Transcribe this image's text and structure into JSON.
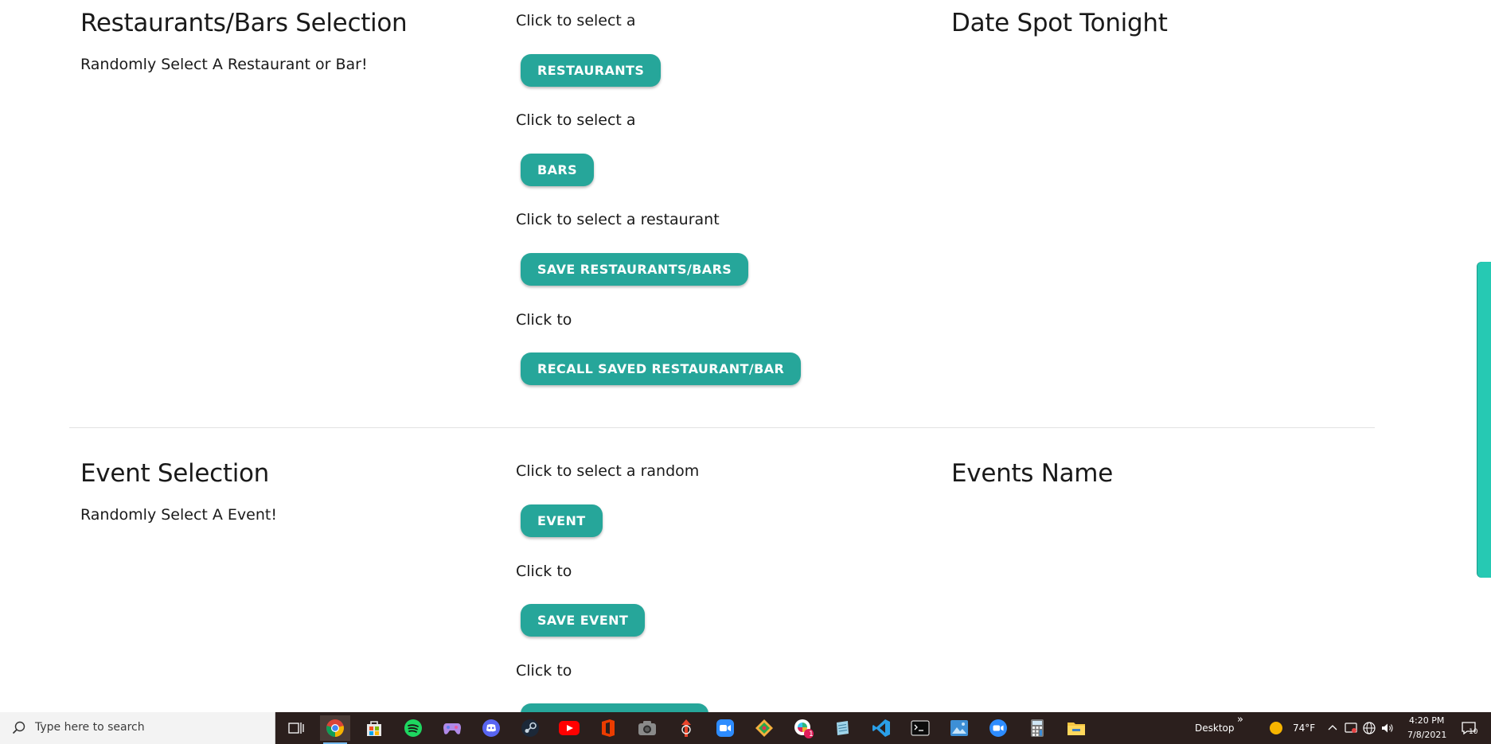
{
  "restaurants_section": {
    "title": "Restaurants/Bars Selection",
    "subtitle": "Randomly Select A Restaurant or Bar!",
    "result_title": "Date Spot Tonight",
    "actions": [
      {
        "hint": "Click to select a",
        "label": "RESTAURANTS"
      },
      {
        "hint": "Click to select a",
        "label": "BARS"
      },
      {
        "hint": "Click to select a restaurant",
        "label": "SAVE RESTAURANTS/BARS"
      },
      {
        "hint": "Click to",
        "label": "RECALL SAVED RESTAURANT/BAR"
      }
    ]
  },
  "event_section": {
    "title": "Event Selection",
    "subtitle": "Randomly Select A Event!",
    "result_title": "Events Name",
    "actions": [
      {
        "hint": "Click to select a random",
        "label": "EVENT"
      },
      {
        "hint": "Click to",
        "label": "SAVE EVENT"
      },
      {
        "hint": "Click to",
        "label": ""
      }
    ]
  },
  "colors": {
    "accent": "#26a69a",
    "scroll_tab": "#26c9b3",
    "taskbar": "#2b1f1d"
  },
  "taskbar": {
    "search_placeholder": "Type here to search",
    "apps": [
      "task-view-icon",
      "chrome-icon",
      "store-icon",
      "spotify-icon",
      "game-icon",
      "discord-icon",
      "steam-icon",
      "youtube-icon",
      "office-icon",
      "camera-icon",
      "app-icon",
      "zoom-icon",
      "gitkraken-icon",
      "slack-icon",
      "notepad-icon",
      "vscode-icon",
      "terminal-icon",
      "photos-icon",
      "zoom-alt-icon",
      "calculator-icon",
      "file-explorer-icon"
    ],
    "slack_badge": "1",
    "desktop_label": "Desktop",
    "chevron": "»",
    "temperature": "74°F",
    "time": "4:20 PM",
    "date": "7/8/2021",
    "notification_count": "10"
  }
}
